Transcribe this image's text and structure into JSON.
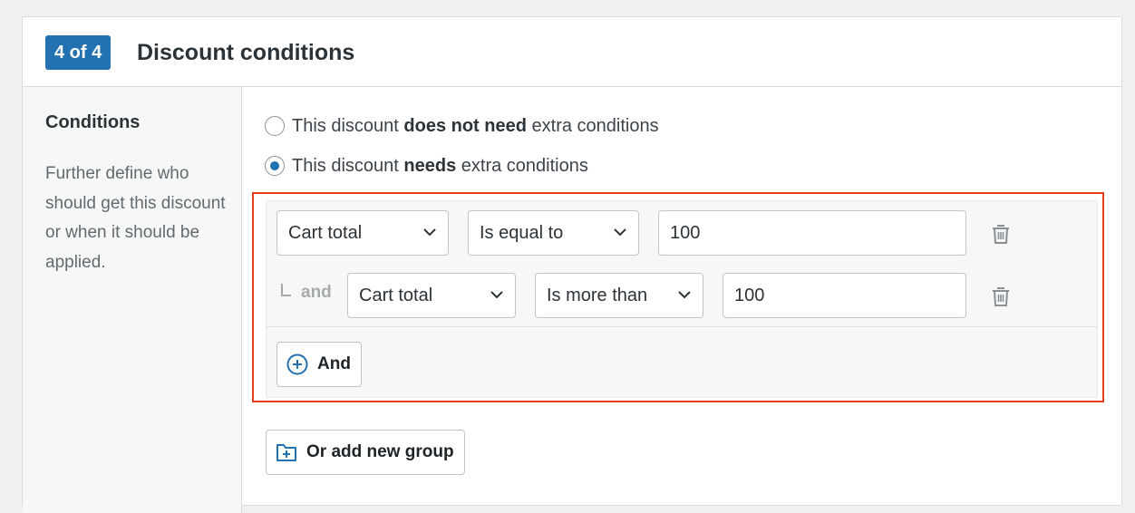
{
  "header": {
    "step_badge": "4 of 4",
    "title": "Discount conditions"
  },
  "sidebar": {
    "title": "Conditions",
    "description": "Further define who should get this discount or when it should be applied."
  },
  "options": [
    {
      "prefix": "This discount ",
      "bold": "does not need",
      "suffix": " extra conditions",
      "checked": false
    },
    {
      "prefix": "This discount ",
      "bold": "needs",
      "suffix": " extra conditions",
      "checked": true
    }
  ],
  "group": {
    "and_connector": "and",
    "rows": [
      {
        "field": "Cart total",
        "operator": "Is equal to",
        "value": "100"
      },
      {
        "field": "Cart total",
        "operator": "Is more than",
        "value": "100"
      }
    ],
    "add_and_label": "And"
  },
  "add_group_label": "Or add new group",
  "colors": {
    "accent": "#2271b1",
    "highlight": "#e53f21"
  }
}
